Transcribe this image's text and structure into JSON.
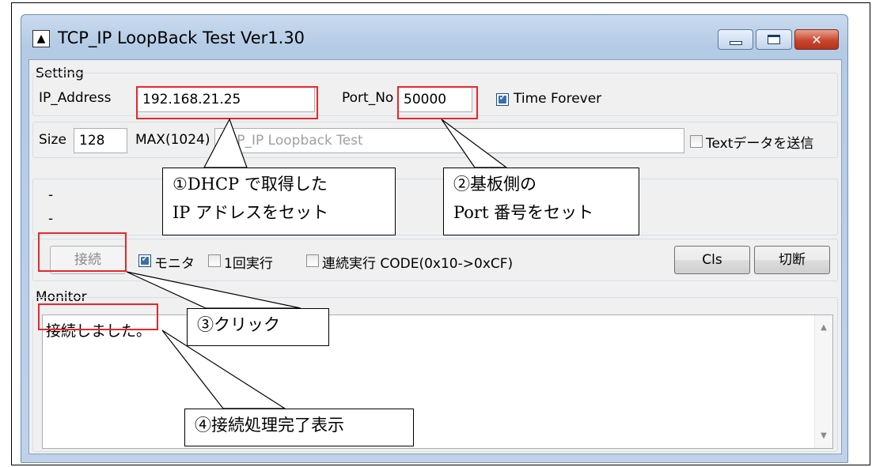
{
  "window": {
    "title": "TCP_IP LoopBack Test Ver1.30",
    "app_icon_glyph": "▲",
    "close_glyph": "✕"
  },
  "setting": {
    "group_label": "Setting",
    "ip_label": "IP_Address",
    "ip_value": "192.168.21.25",
    "port_label": "Port_No",
    "port_value": "50000",
    "time_forever_label": "Time Forever",
    "time_forever_checked": true,
    "size_label": "Size",
    "size_value": "128",
    "max_label": "MAX(1024)",
    "text_value": "TCP_IP Loopback Test",
    "send_text_label": "Textデータを送信",
    "send_text_checked": false,
    "status_line_1": "-",
    "status_line_2": "-"
  },
  "controls": {
    "connect_label": "接続",
    "monitor_label": "モニタ",
    "monitor_checked": true,
    "once_label": "1回実行",
    "once_checked": false,
    "continuous_label": "連続実行 CODE(0x10->0xCF)",
    "continuous_checked": false,
    "cls_label": "Cls",
    "disconnect_label": "切断"
  },
  "monitor": {
    "group_label": "Monitor",
    "text": "接続しました。"
  },
  "annotations": {
    "a1_line1": "①DHCP で取得した",
    "a1_line2": "IP アドレスをセット",
    "a2_line1": "②基板側の",
    "a2_line2": "Port 番号をセット",
    "a3": "③クリック",
    "a4": "④接続処理完了表示",
    "highlight_color": "#e8262c"
  },
  "icons": [
    "app-icon",
    "minimize-icon",
    "maximize-icon",
    "close-icon",
    "scroll-up-icon",
    "scroll-down-icon"
  ]
}
